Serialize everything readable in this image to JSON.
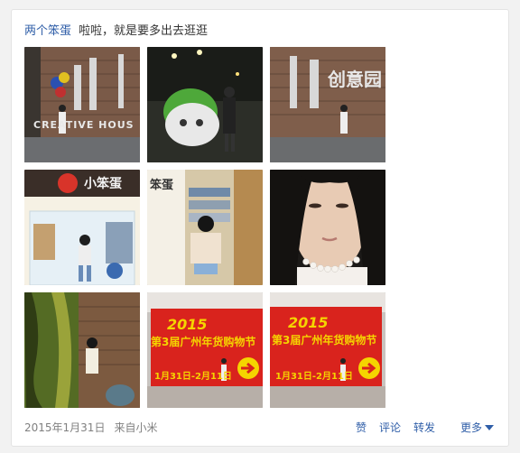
{
  "post": {
    "author": "两个笨蛋",
    "content": "啦啦，就是要多出去逛逛",
    "date": "2015年1月31日",
    "source": "来自小米"
  },
  "photos": [
    {
      "name": "photo-creative-house-wall",
      "sign": "CREATIVE HOUS"
    },
    {
      "name": "photo-chat-logo-night",
      "sign": ""
    },
    {
      "name": "photo-creative-house-sign",
      "sign": "创意园"
    },
    {
      "name": "photo-shop-entrance",
      "sign": "小笨蛋"
    },
    {
      "name": "photo-bookshelf-girl",
      "sign": "笨蛋"
    },
    {
      "name": "photo-selfie-face",
      "sign": ""
    },
    {
      "name": "photo-painted-wall",
      "sign": ""
    },
    {
      "name": "photo-festival-banner-1",
      "sign": "第3届广州年货购物节",
      "year": "2015",
      "dates": "1月31日-2月11日"
    },
    {
      "name": "photo-festival-banner-2",
      "sign": "第3届广州年货购物节",
      "year": "2015",
      "dates": "1月31日-2月11日"
    }
  ],
  "actions": {
    "like": "赞",
    "comment": "评论",
    "repost": "转发",
    "more": "更多"
  },
  "colors": {
    "link": "#2f5ea8",
    "text": "#333333",
    "muted": "#808080",
    "banner_red": "#d9231d",
    "banner_yellow": "#f5d400"
  }
}
